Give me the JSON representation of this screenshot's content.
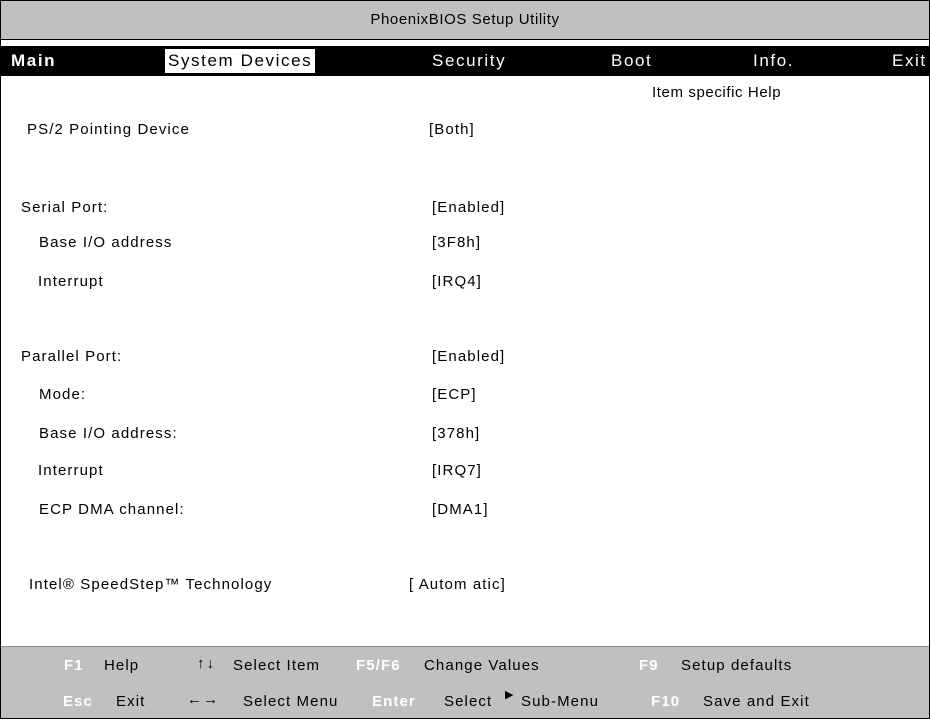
{
  "title": "PhoenixBIOS Setup Utility",
  "menu": {
    "main": "Main",
    "system_devices": "System Devices",
    "security": "Security",
    "boot": "Boot",
    "info": "Info.",
    "exit": "Exit"
  },
  "help_title": "Item specific Help",
  "settings": {
    "ps2_pointing": {
      "label": "PS/2 Pointing Device",
      "value": "[Both]"
    },
    "serial_port": {
      "label": "Serial Port:",
      "value": "[Enabled]"
    },
    "serial_base": {
      "label": "Base I/O address",
      "value": "[3F8h]"
    },
    "serial_irq": {
      "label": "Interrupt",
      "value": "[IRQ4]"
    },
    "parallel_port": {
      "label": "Parallel Port:",
      "value": "[Enabled]"
    },
    "parallel_mode": {
      "label": "Mode:",
      "value": "[ECP]"
    },
    "parallel_base": {
      "label": "Base I/O address:",
      "value": "[378h]"
    },
    "parallel_irq": {
      "label": "Interrupt",
      "value": "[IRQ7]"
    },
    "ecp_dma": {
      "label": "ECP DMA channel:",
      "value": "[DMA1]"
    },
    "speedstep": {
      "label": "Intel® SpeedStep™ Technology",
      "value": "[ Autom atic]"
    }
  },
  "status": {
    "f1_key": "F1",
    "f1_text": "Help",
    "arrows_ud": "↑↓",
    "select_item": "Select Item",
    "f5f6_key": "F5/F6",
    "change_values": "Change Values",
    "f9_key": "F9",
    "setup_defaults": "Setup defaults",
    "esc_key": "Esc",
    "esc_text": "Exit",
    "arrows_lr": "←→",
    "select_menu": "Select Menu",
    "enter_key": "Enter",
    "select_text": "Select",
    "triangle": "▶",
    "sub_menu": "Sub-Menu",
    "f10_key": "F10",
    "save_exit": "Save and Exit"
  }
}
